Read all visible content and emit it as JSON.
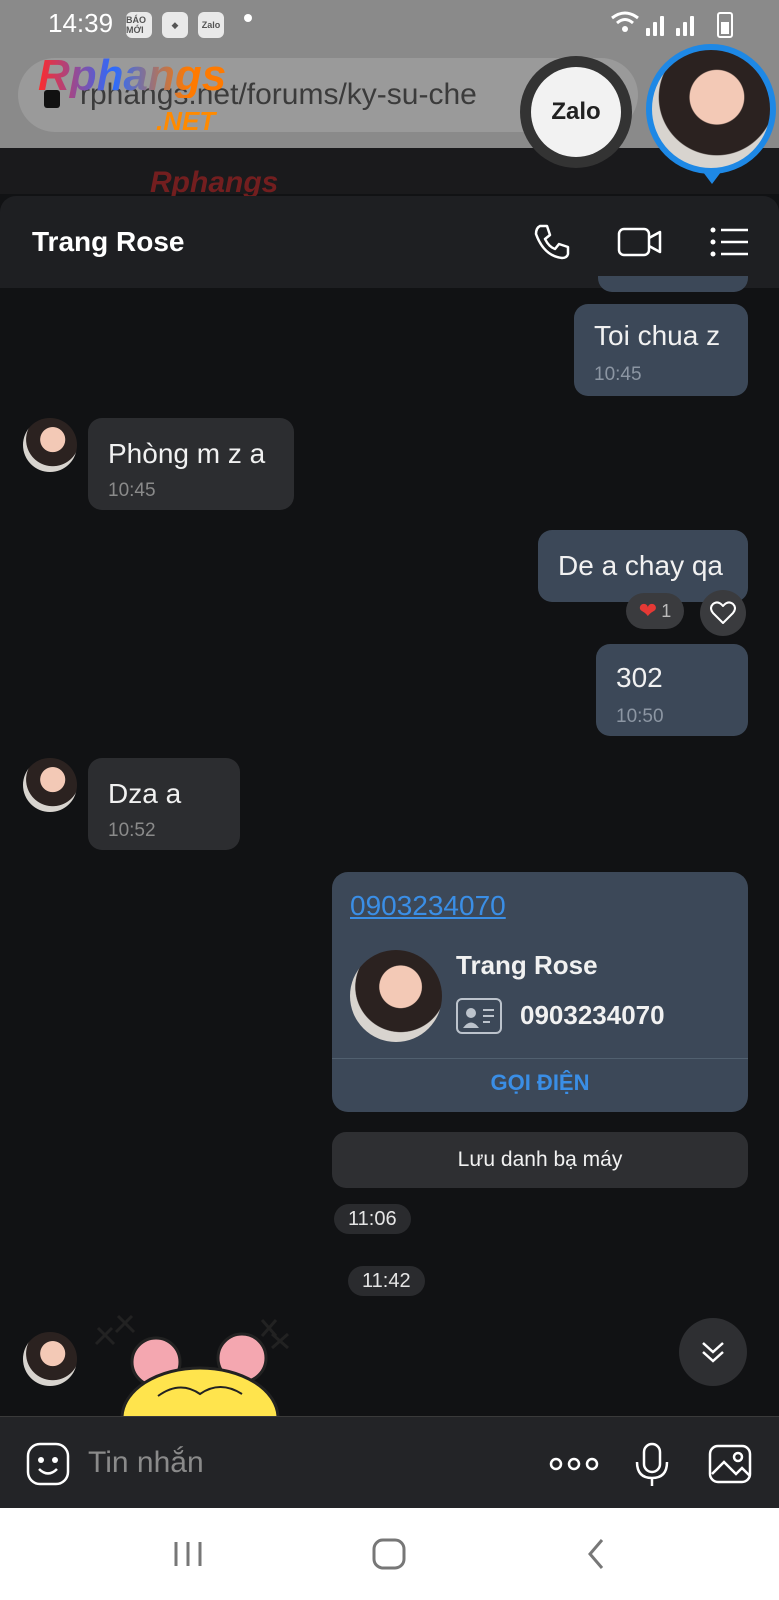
{
  "status_bar": {
    "time": "14:39",
    "app_icons": [
      "BÁO MỚI",
      "game-app",
      "Zalo"
    ]
  },
  "browser": {
    "url": "rphangs.net/forums/ky-su-che",
    "brand_logo": "Rphangs",
    "brand_logo_suffix": ".NET"
  },
  "chat_head": {
    "app_label": "Zalo"
  },
  "chat": {
    "contact_name": "Trang Rose",
    "messages": [
      {
        "from": "me",
        "text": "Toi chua z",
        "time": "10:45"
      },
      {
        "from": "them",
        "text": "Phòng m z a",
        "time": "10:45"
      },
      {
        "from": "me",
        "text": "De a chay qa",
        "time": "",
        "reaction_count": "1"
      },
      {
        "from": "me",
        "text": "302",
        "time": "10:50"
      },
      {
        "from": "them",
        "text": "Dza a",
        "time": "10:52"
      }
    ],
    "contact_card": {
      "phone_link": "0903234070",
      "name": "Trang Rose",
      "phone": "0903234070",
      "call_label": "GỌI ĐIỆN"
    },
    "save_contact_label": "Lưu danh bạ máy",
    "time_pills": [
      "11:06",
      "11:42"
    ]
  },
  "input": {
    "placeholder": "Tin nhắn"
  },
  "colors": {
    "accent": "#3a8ee6",
    "my_bubble": "#3c4858",
    "their_bubble": "#2c2d30",
    "background": "#111214"
  }
}
